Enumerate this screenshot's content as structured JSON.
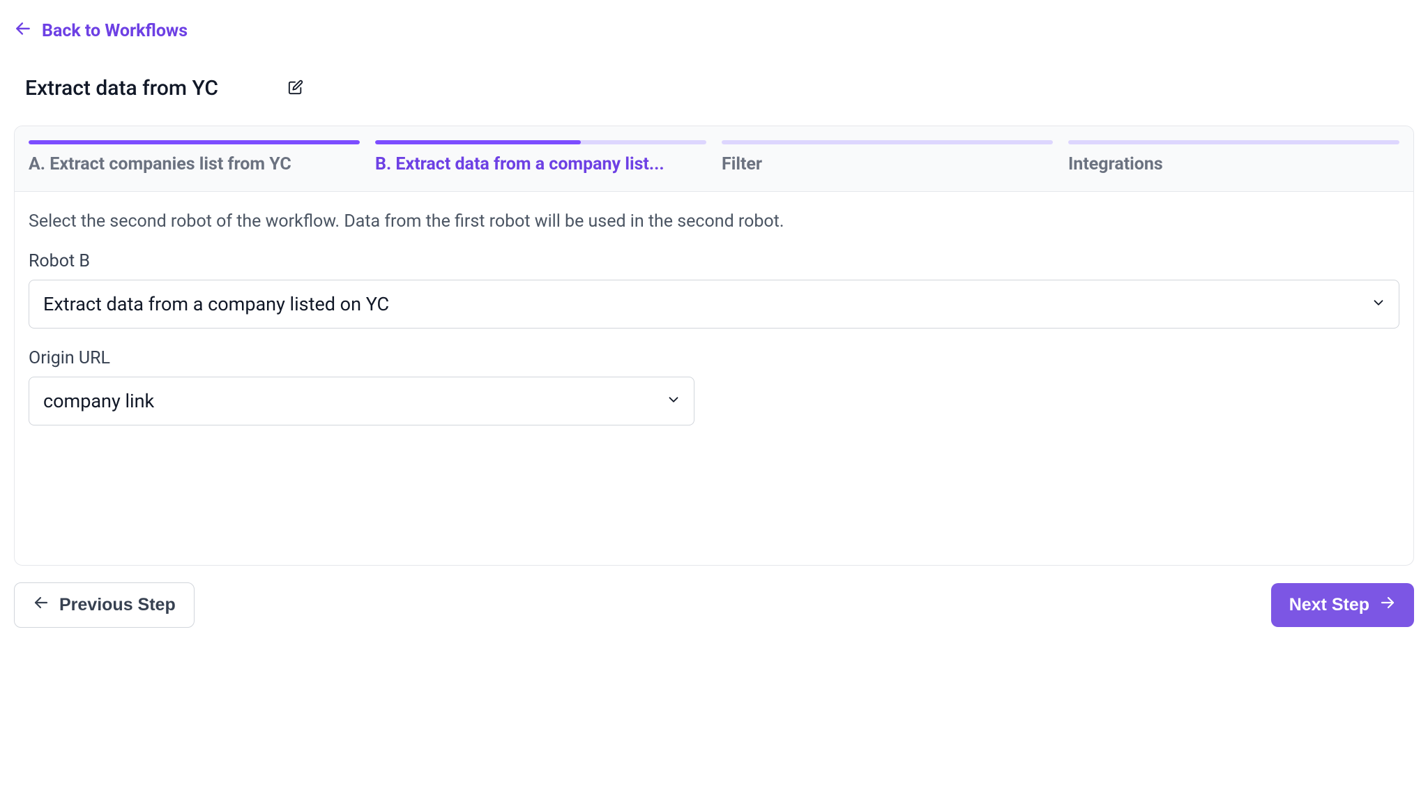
{
  "header": {
    "back_label": "Back to Workflows",
    "title": "Extract data from YC"
  },
  "stepper": {
    "steps": [
      {
        "label": "A. Extract companies list from YC",
        "state": "completed"
      },
      {
        "label": "B. Extract data from a company list...",
        "state": "active"
      },
      {
        "label": "Filter",
        "state": "upcoming"
      },
      {
        "label": "Integrations",
        "state": "upcoming"
      }
    ]
  },
  "body": {
    "instruction": "Select the second robot of the workflow. Data from the first robot will be used in the second robot.",
    "robot_b_label": "Robot B",
    "robot_b_value": "Extract data from a company listed on YC",
    "origin_url_label": "Origin URL",
    "origin_url_value": "company link"
  },
  "footer": {
    "prev_label": "Previous Step",
    "next_label": "Next Step"
  }
}
